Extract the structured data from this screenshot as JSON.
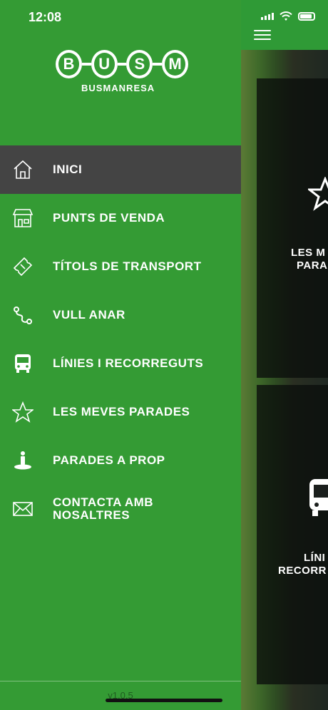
{
  "status": {
    "time": "12:08"
  },
  "logo": {
    "letters": [
      "B",
      "U",
      "S",
      "M"
    ],
    "subtitle": "BUSMANRESA"
  },
  "menu": [
    {
      "label": "INICI",
      "icon": "home-icon",
      "active": true
    },
    {
      "label": "PUNTS DE VENDA",
      "icon": "store-icon",
      "active": false
    },
    {
      "label": "TÍTOLS DE TRANSPORT",
      "icon": "ticket-icon",
      "active": false
    },
    {
      "label": "VULL ANAR",
      "icon": "route-icon",
      "active": false
    },
    {
      "label": "LÍNIES I RECORREGUTS",
      "icon": "bus-icon",
      "active": false
    },
    {
      "label": "LES MEVES PARADES",
      "icon": "star-icon",
      "active": false
    },
    {
      "label": "PARADES A PROP",
      "icon": "location-person-icon",
      "active": false
    },
    {
      "label": "CONTACTA AMB NOSALTRES",
      "icon": "mail-icon",
      "active": false
    }
  ],
  "version": "v1.0.5",
  "background_cards": [
    {
      "label": "LES M\nPARA",
      "icon": "star-icon"
    },
    {
      "label": "LÍNI\nRECORR",
      "icon": "bus-icon"
    }
  ],
  "colors": {
    "drawer_green": "#349b34",
    "active_bg": "#444444"
  }
}
